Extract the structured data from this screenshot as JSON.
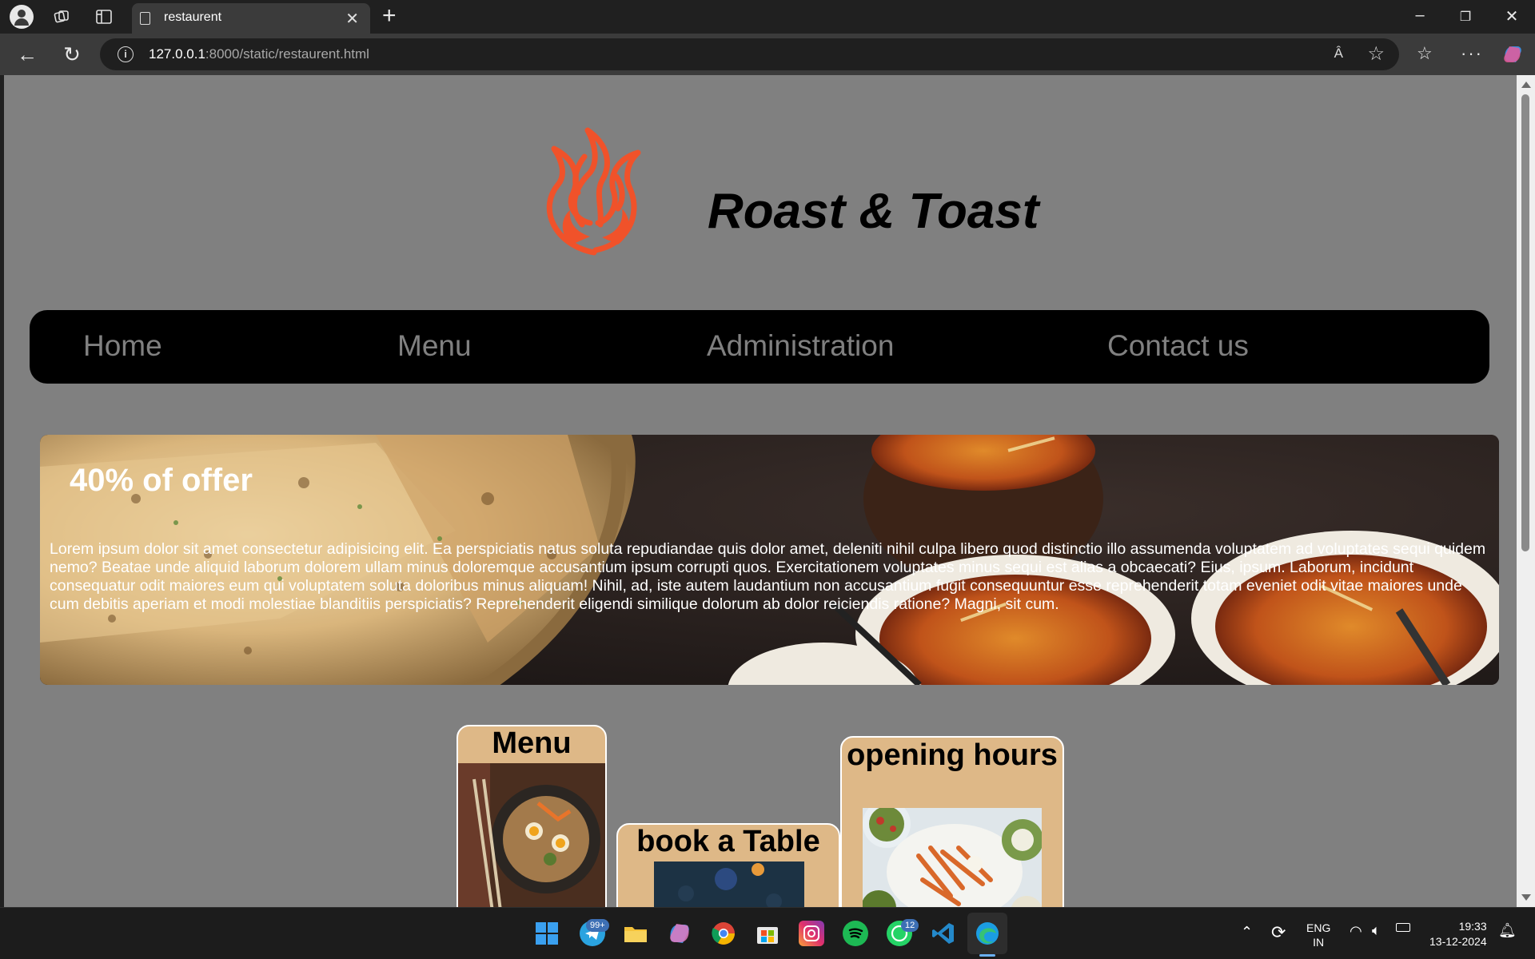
{
  "browser": {
    "tab_title": "restaurent",
    "url_host": "127.0.0.1",
    "url_rest": ":8000/static/restaurent.html",
    "read_aloud_icon": "Â"
  },
  "site": {
    "title": "Roast & Toast",
    "logo_icon": "flame-logo",
    "nav": [
      "Home",
      "Menu",
      "Administration",
      "Contact us"
    ],
    "hero": {
      "heading": "40% of offer",
      "text": "Lorem ipsum dolor sit amet consectetur adipisicing elit. Ea perspiciatis natus soluta repudiandae quis dolor amet, deleniti nihil culpa libero quod distinctio illo assumenda voluptatem ad voluptates sequi quidem nemo? Beatae unde aliquid laborum dolorem ullam minus doloremque accusantium ipsum corrupti quos. Exercitationem voluptates minus sequi est alias a obcaecati? Eius, ipsum. Laborum, incidunt consequatur odit maiores eum qui voluptatem soluta doloribus minus aliquam! Nihil, ad, iste autem laudantium non accusantium fugit consequuntur esse reprehenderit totam eveniet odit vitae maiores unde cum debitis aperiam et modi molestiae blanditiis perspiciatis? Reprehenderit eligendi similique dolorum ab dolor reiciendis ratione? Magni, sit cum."
    },
    "cards": {
      "menu": "Menu",
      "book": "book a Table",
      "hours": "opening hours"
    },
    "colors": {
      "page_bg": "#808080",
      "nav_bg": "#000000",
      "nav_text": "#808080",
      "card_bg": "#deb887",
      "logo": "#f0522a"
    }
  },
  "taskbar": {
    "telegram_badge": "99+",
    "whatsapp_badge": "12",
    "lang_1": "ENG",
    "lang_2": "IN",
    "time": "19:33",
    "date": "13-12-2024"
  }
}
